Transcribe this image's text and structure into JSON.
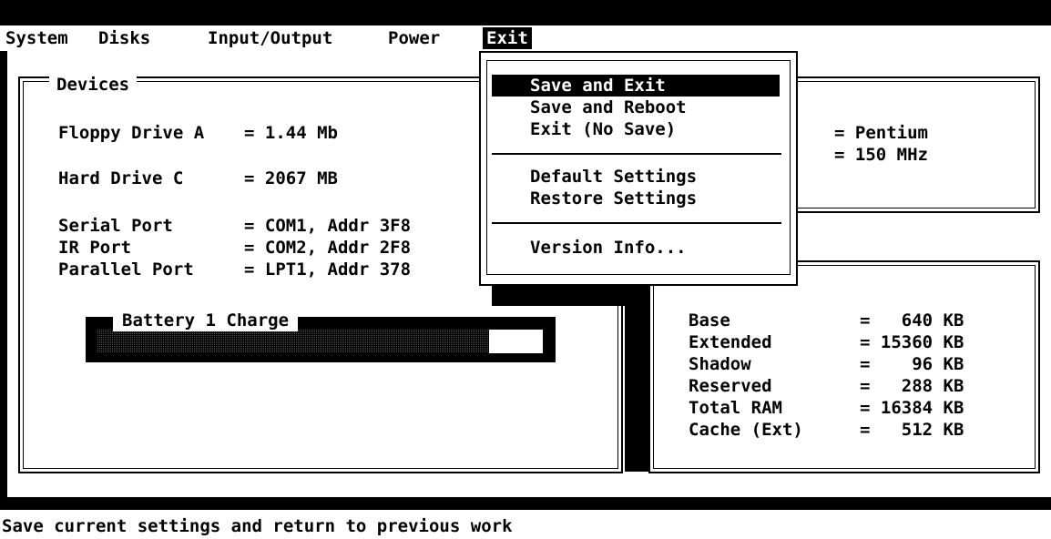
{
  "menubar": {
    "items": [
      "System",
      "Disks",
      "Input/Output",
      "Power",
      "Exit"
    ],
    "active": "Exit"
  },
  "devices": {
    "title": "Devices",
    "floppy": {
      "label": "Floppy Drive A",
      "value": "= 1.44 Mb"
    },
    "hdd": {
      "label": "Hard Drive C",
      "value": "= 2067 MB"
    },
    "serial": {
      "label": "Serial Port",
      "value": "= COM1, Addr 3F8"
    },
    "ir": {
      "label": "IR Port",
      "value": "= COM2, Addr 2F8"
    },
    "parallel": {
      "label": "Parallel Port",
      "value": "= LPT1, Addr 378"
    }
  },
  "battery": {
    "title": "Battery 1 Charge",
    "charge_fraction": 0.88
  },
  "processor": {
    "type_value": "= Pentium",
    "speed_value": "= 150 MHz"
  },
  "memory": {
    "rows": [
      {
        "label": "Base",
        "value": "=   640 KB"
      },
      {
        "label": "Extended",
        "value": "= 15360 KB"
      },
      {
        "label": "Shadow",
        "value": "=    96 KB"
      },
      {
        "label": "Reserved",
        "value": "=   288 KB"
      },
      {
        "label": "Total RAM",
        "value": "= 16384 KB"
      },
      {
        "label": "Cache (Ext)",
        "value": "=   512 KB"
      }
    ]
  },
  "exit_menu": {
    "items": [
      "Save and Exit",
      "Save and Reboot",
      "Exit (No Save)",
      "Default Settings",
      "Restore Settings",
      "Version Info..."
    ],
    "selected": "Save and Exit"
  },
  "status": {
    "text": "Save current settings and return to previous work"
  },
  "colors": {
    "foreground": "#000000",
    "background": "#ffffff"
  }
}
